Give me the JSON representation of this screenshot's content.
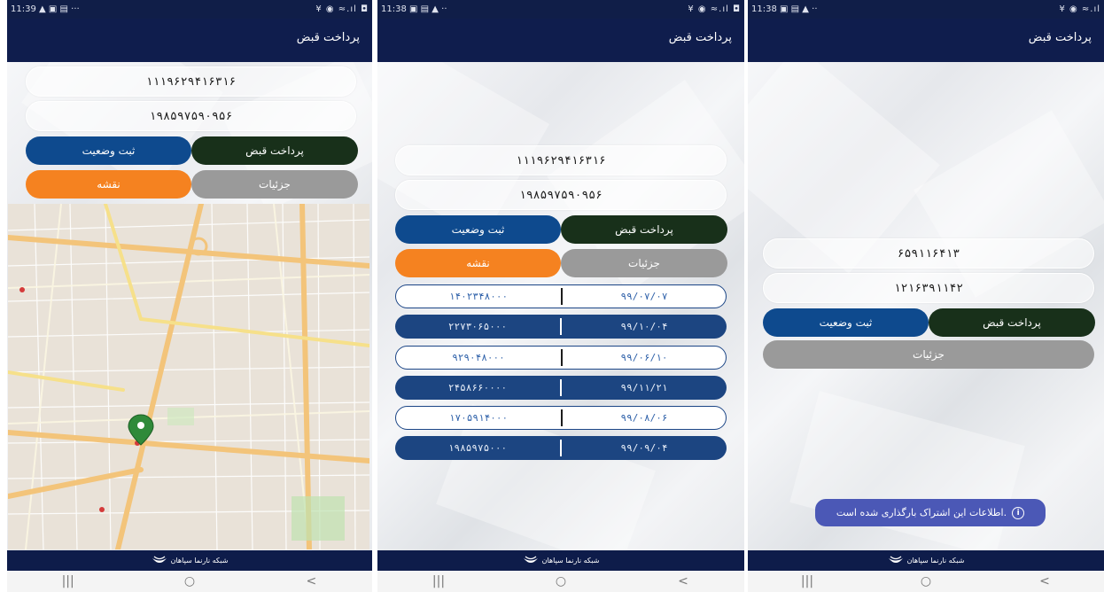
{
  "screens": [
    {
      "time": "11:39",
      "status_icons_left": "▲ ▣ ▤ ···",
      "status_icons_right": "¥ ◉ ≈.ıl ◘",
      "title": "پرداخت قبض",
      "field1": "۱۱۱۹۶۲۹۴۱۶۳۱۶",
      "field2": "۱۹۸۵۹۷۵۹۰۹۵۶",
      "btn_pay": "پرداخت قبض",
      "btn_register": "ثبت وضعیت",
      "btn_details": "جزئیات",
      "btn_map": "نقشه"
    },
    {
      "time": "11:38",
      "status_icons_left": "▣ ▤ ▲ ··",
      "status_icons_right": "¥ ◉ ≈.ıl ◘",
      "title": "پرداخت قبض",
      "field1": "۱۱۱۹۶۲۹۴۱۶۳۱۶",
      "field2": "۱۹۸۵۹۷۵۹۰۹۵۶",
      "btn_pay": "پرداخت قبض",
      "btn_register": "ثبت وضعیت",
      "btn_details": "جزئیات",
      "btn_map": "نقشه",
      "rows": [
        {
          "amount": "۱۴۰۲۳۴۸۰۰۰",
          "date": "۹۹/۰۷/۰۷"
        },
        {
          "amount": "۲۲۷۳۰۶۵۰۰۰",
          "date": "۹۹/۱۰/۰۴"
        },
        {
          "amount": "۹۲۹۰۴۸۰۰۰",
          "date": "۹۹/۰۶/۱۰"
        },
        {
          "amount": "۲۴۵۸۶۶۰۰۰۰",
          "date": "۹۹/۱۱/۲۱"
        },
        {
          "amount": "۱۷۰۵۹۱۴۰۰۰",
          "date": "۹۹/۰۸/۰۶"
        },
        {
          "amount": "۱۹۸۵۹۷۵۰۰۰",
          "date": "۹۹/۰۹/۰۴"
        }
      ]
    },
    {
      "time": "11:38",
      "status_icons_left": "▣ ▤ ▲ ··",
      "status_icons_right": "¥ ◉ ≈.ıl",
      "title": "پرداخت قبض",
      "field1": "۶۵۹۱۱۶۴۱۳",
      "field2": "۱۲۱۶۳۹۱۱۴۲",
      "btn_pay": "پرداخت قبض",
      "btn_register": "ثبت وضعیت",
      "btn_details": "جزئیات",
      "toast": "اطلاعات این اشتراک بارگذاری شده است.",
      "toast_icon": "i"
    }
  ],
  "footer_text": "شبکه نارنما سپاهان",
  "nav": {
    "recent": "|||",
    "home": "○",
    "back": "<"
  },
  "colors": {
    "navy": "#0f1d4d",
    "dark_green": "#18301a",
    "blue": "#0e4a8e",
    "orange": "#f58220",
    "gray": "#9a9a9a",
    "toast": "#4b58b6"
  }
}
